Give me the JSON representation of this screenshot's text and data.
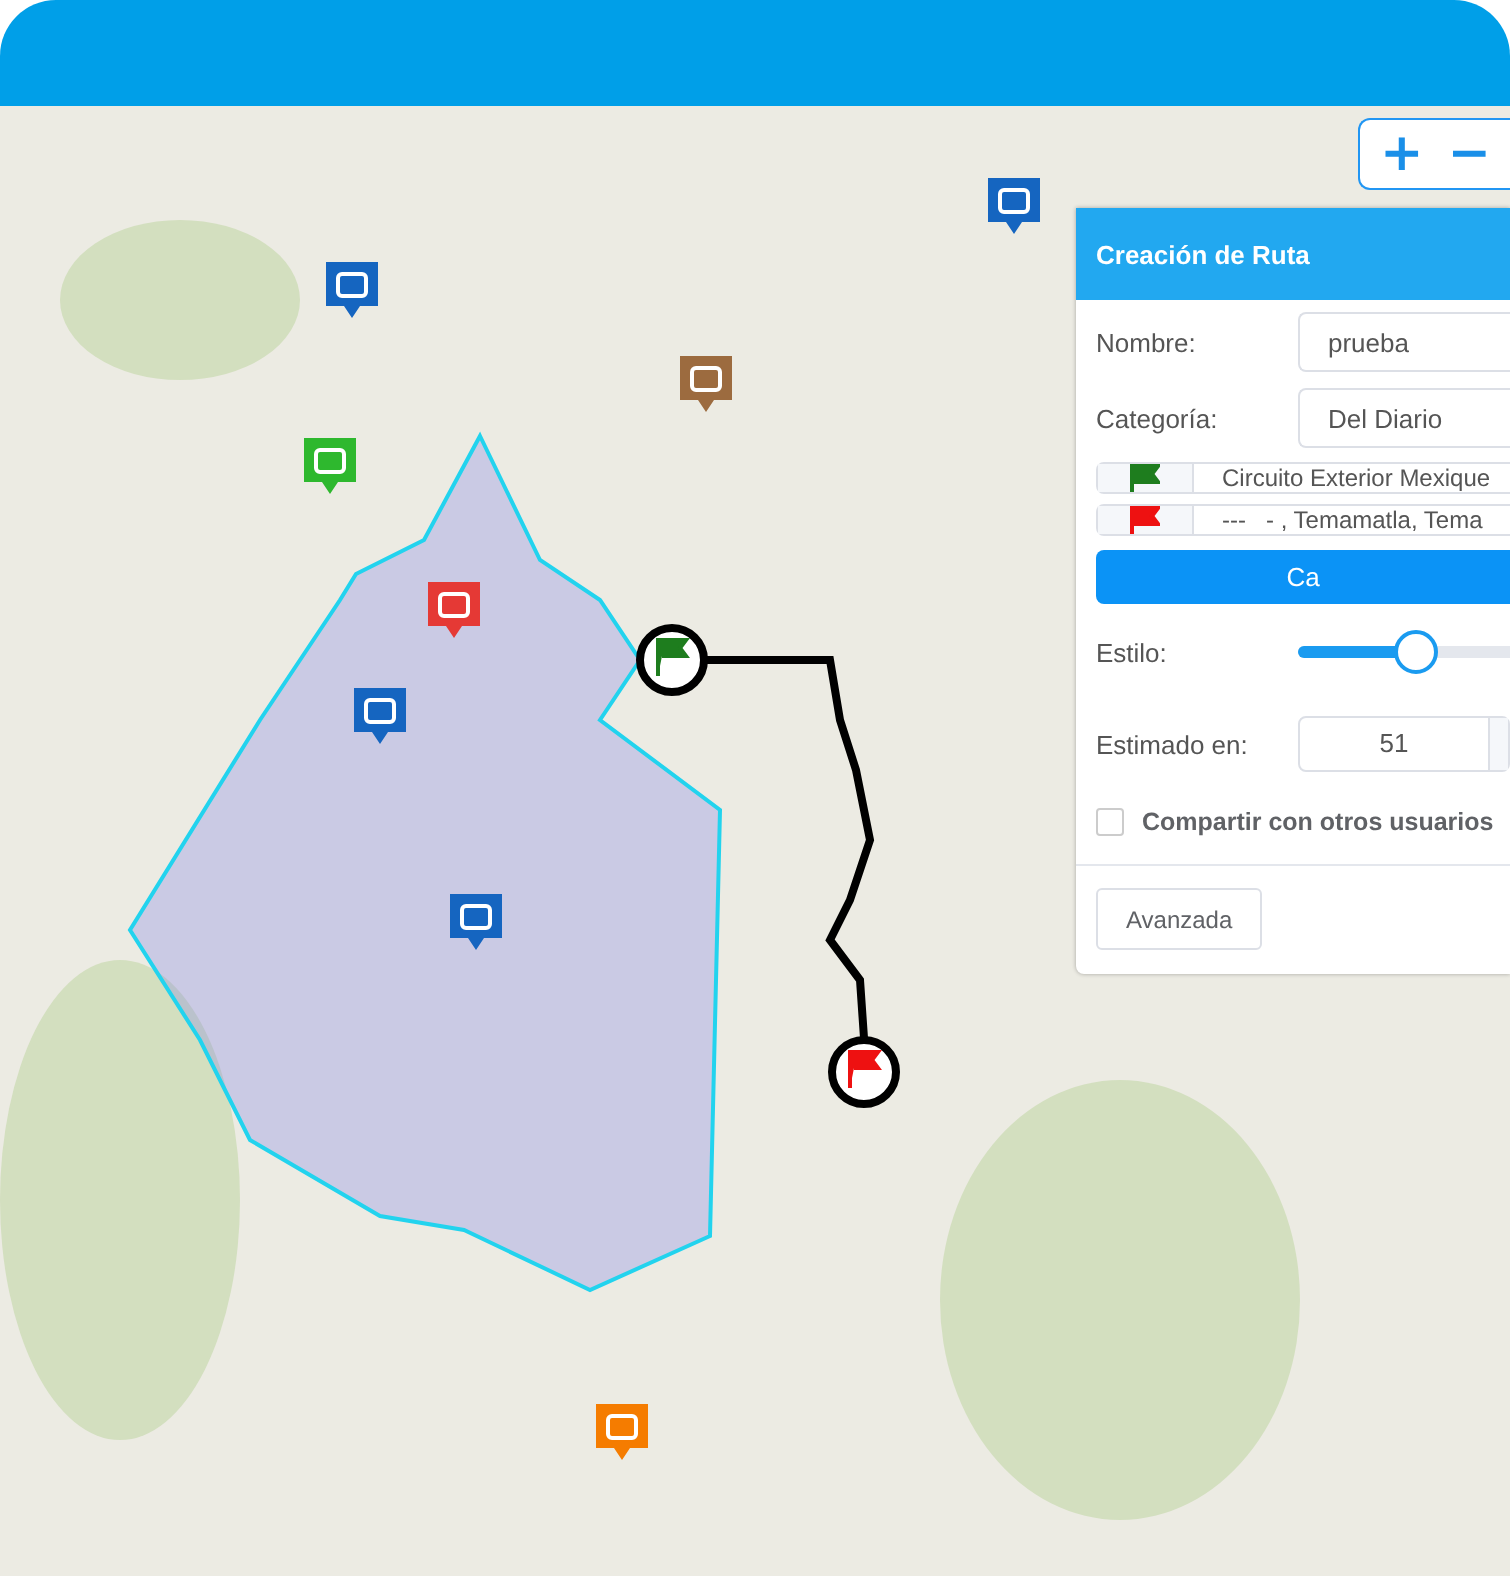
{
  "zoom_controls": [
    {
      "symbol": "+"
    },
    {
      "symbol": "−"
    }
  ],
  "panel": {
    "title": "Creación de Ruta",
    "fields": [
      {
        "label": "Nombre:",
        "value": "prueba"
      },
      {
        "label": "Categoría:",
        "value": "Del Diario"
      }
    ],
    "waypoints": [
      {
        "kind": "start",
        "value": "Circuito Exterior Mexique"
      },
      {
        "kind": "end",
        "value": "---   - , Temamatla, Tema"
      }
    ],
    "calculate_button": "Ca",
    "style_slider": {
      "label": "Estilo:",
      "level": 0.55
    },
    "estimate": {
      "label": "Estimado en:",
      "value": "51"
    },
    "share": {
      "label": "Compartir con otros usuarios",
      "checked": false
    },
    "advanced_button": "Avanzada"
  }
}
